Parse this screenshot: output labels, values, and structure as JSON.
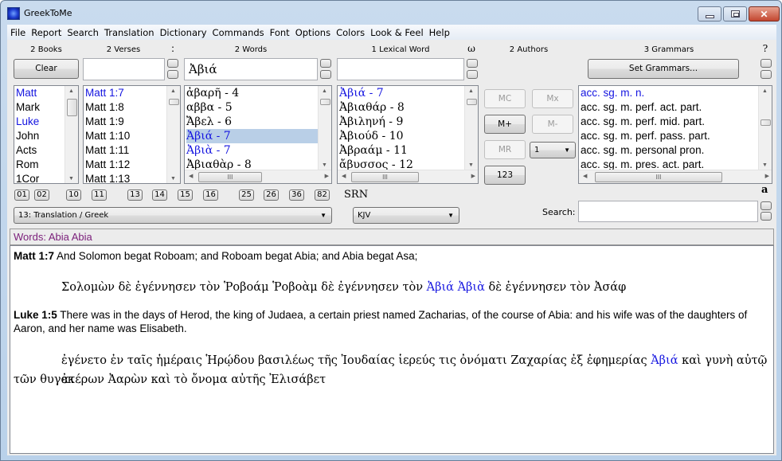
{
  "window": {
    "title": "GreekToMe",
    "controls": {
      "minimize": "—",
      "maximize": "□",
      "close": "✕"
    }
  },
  "menu": [
    "File",
    "Report",
    "Search",
    "Translation",
    "Dictionary",
    "Commands",
    "Font",
    "Options",
    "Colors",
    "Look & Feel",
    "Help"
  ],
  "headers": {
    "books": "2 Books",
    "verses": "2 Verses",
    "colon": ":",
    "words": "2 Words",
    "lexical": "1 Lexical Word",
    "omega": "ω",
    "authors": "2 Authors",
    "grammars": "3 Grammars",
    "help": "?"
  },
  "buttons": {
    "clear": "Clear",
    "set_grammars": "Set Grammars...",
    "mc": "MC",
    "mx": "Mx",
    "mplus": "M+",
    "mminus": "M-",
    "mr": "MR",
    "n123": "123"
  },
  "inputs": {
    "verses_value": "",
    "words_value": "Ἀβιά",
    "lexical_value": "",
    "search_label": "Search:",
    "search_value": ""
  },
  "lists": {
    "books": [
      {
        "text": "Matt",
        "highlighted": true
      },
      {
        "text": "Mark",
        "highlighted": false
      },
      {
        "text": "Luke",
        "highlighted": true
      },
      {
        "text": "John",
        "highlighted": false
      },
      {
        "text": "Acts",
        "highlighted": false
      },
      {
        "text": "Rom",
        "highlighted": false
      },
      {
        "text": "1Cor",
        "highlighted": false
      }
    ],
    "verses": [
      {
        "text": "Matt 1:7",
        "highlighted": true
      },
      {
        "text": "Matt 1:8",
        "highlighted": false
      },
      {
        "text": "Matt 1:9",
        "highlighted": false
      },
      {
        "text": "Matt 1:10",
        "highlighted": false
      },
      {
        "text": "Matt 1:11",
        "highlighted": false
      },
      {
        "text": "Matt 1:12",
        "highlighted": false
      },
      {
        "text": "Matt 1:13",
        "highlighted": false
      }
    ],
    "words": [
      {
        "text": "ἀβαρῆ - 4",
        "highlighted": false,
        "selected": false
      },
      {
        "text": "αββα - 5",
        "highlighted": false,
        "selected": false
      },
      {
        "text": "Ἄβελ - 6",
        "highlighted": false,
        "selected": false
      },
      {
        "text": "Ἀβιά - 7",
        "highlighted": true,
        "selected": true
      },
      {
        "text": "Ἀβιὰ - 7",
        "highlighted": true,
        "selected": false
      },
      {
        "text": "Ἀβιαθὰρ - 8",
        "highlighted": false,
        "selected": false
      }
    ],
    "lexical": [
      {
        "text": "Ἀβιά - 7",
        "highlighted": true
      },
      {
        "text": "Ἀβιαθάρ - 8",
        "highlighted": false
      },
      {
        "text": "Ἀβιληνή - 9",
        "highlighted": false
      },
      {
        "text": "Ἀβιούδ - 10",
        "highlighted": false
      },
      {
        "text": "Ἀβραάμ - 11",
        "highlighted": false
      },
      {
        "text": "ἄβυσσος - 12",
        "highlighted": false
      }
    ],
    "grammars": [
      {
        "text": "acc. sg. m. n.",
        "highlighted": true
      },
      {
        "text": "acc. sg. m. perf. act. part.",
        "highlighted": false
      },
      {
        "text": "acc. sg. m. perf. mid. part.",
        "highlighted": false
      },
      {
        "text": "acc. sg. m. perf. pass. part.",
        "highlighted": false
      },
      {
        "text": "acc. sg. m. personal pron.",
        "highlighted": false
      },
      {
        "text": "acc. sg. m. pres. act. part.",
        "highlighted": false
      }
    ]
  },
  "author_count_select": "1",
  "book_number_buttons": [
    "01",
    "02",
    "10",
    "11",
    "13",
    "14",
    "15",
    "16",
    "25",
    "26",
    "36",
    "82"
  ],
  "translation_select": "13:  Translation / Greek",
  "srn_label": "SRN",
  "version_select": "KJV",
  "font_a_label": "a",
  "words_bar": "Words: Abia Abia",
  "passages": [
    {
      "ref": "Matt 1:7",
      "english": "And Solomon begat Roboam; and Roboam begat Abia; and Abia begat Asa;",
      "greek_before": "Σολομὼν δὲ ἐγέννησεν τὸν Ῥοβοάμ Ῥοβοὰμ δὲ ἐγέννησεν τὸν ",
      "greek_highlight": "Ἀβιά Ἀβιὰ",
      "greek_after": " δὲ ἐγέννησεν τὸν Ἀσάφ"
    },
    {
      "ref": "Luke 1:5",
      "english": "There was in the days of Herod, the king of Judaea, a certain priest named Zacharias, of the course of Abia: and his wife was of the daughters of Aaron, and her name was Elisabeth.",
      "greek_before": "ἐγένετο ἐν ταῖς ἡμέραις Ἡρῴδου βασιλέως τῆς Ἰουδαίας ἱερεύς τις ὀνόματι Ζαχαρίας ἐξ ἐφημερίας ",
      "greek_highlight": "Ἀβιά",
      "greek_after": " καὶ γυνὴ αὐτῷ ἐκ",
      "greek_line2": "τῶν θυγατέρων Ἀαρὼν καὶ τὸ ὄνομα αὐτῆς Ἐλισάβετ"
    }
  ]
}
